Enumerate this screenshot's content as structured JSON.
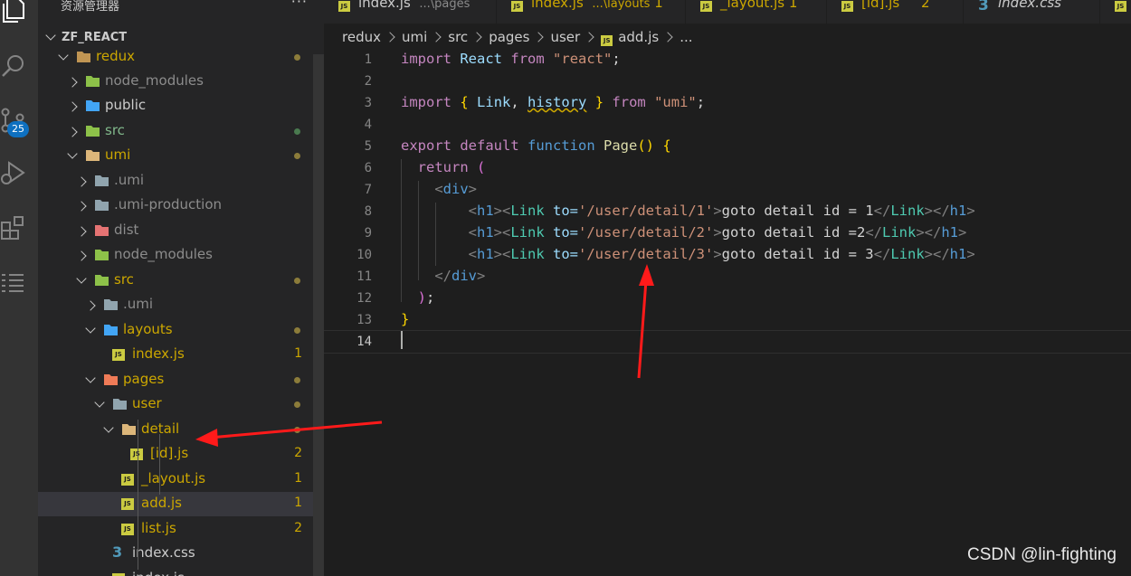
{
  "sidebar": {
    "title": "资源管理器",
    "more": "···",
    "project": "ZF_REACT",
    "items": [
      {
        "label": "redux",
        "kind": "folder-open",
        "status": "dot"
      },
      {
        "label": "node_modules",
        "kind": "folder",
        "status": ""
      },
      {
        "label": "public",
        "kind": "folder",
        "status": ""
      },
      {
        "label": "src",
        "kind": "folder",
        "status": "dot"
      },
      {
        "label": "umi",
        "kind": "folder-open",
        "status": "dot"
      },
      {
        "label": ".umi",
        "kind": "folder",
        "status": ""
      },
      {
        "label": ".umi-production",
        "kind": "folder",
        "status": ""
      },
      {
        "label": "dist",
        "kind": "folder",
        "status": ""
      },
      {
        "label": "node_modules",
        "kind": "folder",
        "status": ""
      },
      {
        "label": "src",
        "kind": "folder-open",
        "status": "dot"
      },
      {
        "label": ".umi",
        "kind": "folder",
        "status": ""
      },
      {
        "label": "layouts",
        "kind": "folder-open",
        "status": "dot"
      },
      {
        "label": "index.js",
        "kind": "js",
        "status": "1"
      },
      {
        "label": "pages",
        "kind": "folder-open",
        "status": "dot"
      },
      {
        "label": "user",
        "kind": "folder-open",
        "status": "dot"
      },
      {
        "label": "detail",
        "kind": "folder-open",
        "status": "dot"
      },
      {
        "label": "[id].js",
        "kind": "js",
        "status": "2"
      },
      {
        "label": "_layout.js",
        "kind": "js",
        "status": "1"
      },
      {
        "label": "add.js",
        "kind": "js",
        "status": "1"
      },
      {
        "label": "list.js",
        "kind": "js",
        "status": "2"
      },
      {
        "label": "index.css",
        "kind": "css",
        "status": ""
      },
      {
        "label": "index.js",
        "kind": "js",
        "status": ""
      }
    ],
    "source_control_badge": "25"
  },
  "tabs": [
    {
      "name": "index.js",
      "suffix": "...\\pages",
      "count": ""
    },
    {
      "name": "index.js",
      "suffix": "...\\layouts",
      "count": "1"
    },
    {
      "name": "_layout.js",
      "suffix": "",
      "count": "1"
    },
    {
      "name": "[id].js",
      "suffix": "",
      "count": "2"
    },
    {
      "name": "index.css",
      "suffix": "",
      "count": ""
    }
  ],
  "breadcrumb": [
    "redux",
    "umi",
    "src",
    "pages",
    "user",
    "add.js",
    "..."
  ],
  "line_numbers": [
    "1",
    "2",
    "3",
    "4",
    "5",
    "6",
    "7",
    "8",
    "9",
    "10",
    "11",
    "12",
    "13",
    "14"
  ],
  "code": {
    "l1": {
      "kw": "import",
      "id": "React",
      "from": "from",
      "str": "\"react\"",
      "end": ";"
    },
    "l3": {
      "kw": "import",
      "open": "{",
      "a": "Link",
      "comma": ",",
      "b": "history",
      "close": "}",
      "from": "from",
      "str": "\"umi\"",
      "end": ";"
    },
    "l5": {
      "exp": "export",
      "def": "default",
      "fnk": "function",
      "fn": "Page",
      "paren": "()",
      "brace": "{"
    },
    "l6": {
      "ret": "return",
      "paren": "("
    },
    "l7": {
      "tag": "div"
    },
    "l8": {
      "to": "to=",
      "path": "'/user/detail/1'",
      "text": "goto detail id = 1"
    },
    "l9": {
      "to": "to=",
      "path": "'/user/detail/2'",
      "text": "goto detail id =2"
    },
    "l10": {
      "to": "to=",
      "path": "'/user/detail/3'",
      "text": "goto detail id = 3"
    },
    "l11": {
      "tag": "div"
    },
    "l12": {
      "text": ");"
    },
    "l13": {
      "text": "}"
    }
  },
  "watermark": "CSDN @lin-fighting",
  "colors": {
    "accent_badge": "#0e70c0",
    "js_icon": "#cbcb41",
    "git_dot": "#8c7c3a",
    "error_count": "#cca700",
    "annotation_arrow": "#ff0000"
  }
}
